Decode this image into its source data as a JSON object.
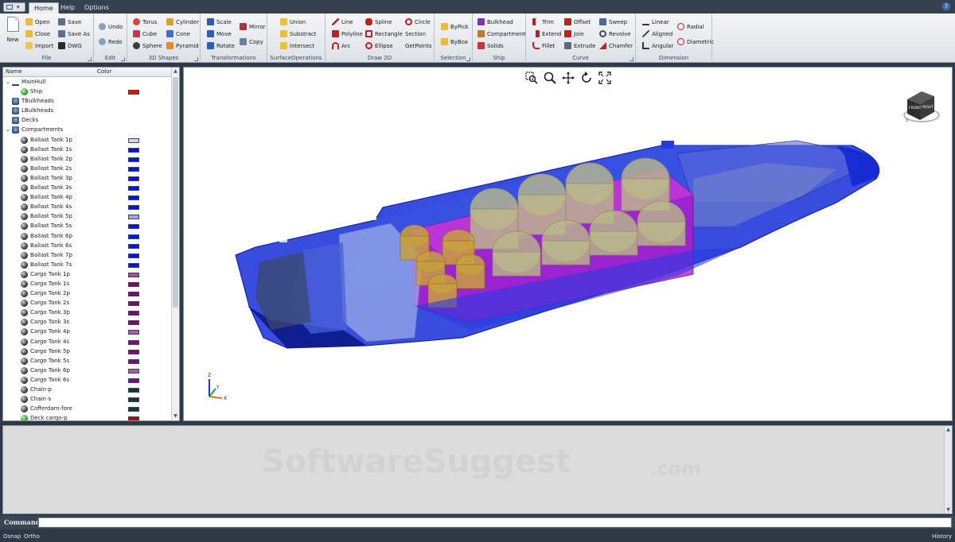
{
  "tabs": [
    "Home",
    "Help",
    "Options"
  ],
  "ribbon": {
    "file": {
      "label": "File",
      "new": "New",
      "open": "Open",
      "close": "Close",
      "import": "Import",
      "save": "Save",
      "save_as": "Save As",
      "dwg": "DWG"
    },
    "edit": {
      "label": "Edit",
      "undo": "Undo",
      "redo": "Redo"
    },
    "shapes3d": {
      "label": "3D Shapes",
      "torus": "Torus",
      "cube": "Cube",
      "sphere": "Sphere",
      "cylinder": "Cylinder",
      "cone": "Cone",
      "pyramid": "Pyramid"
    },
    "transformations": {
      "label": "Transformations",
      "scale": "Scale",
      "move": "Move",
      "rotate": "Rotate",
      "mirror": "Mirror",
      "copy": "Copy"
    },
    "surface_ops": {
      "label": "SurfaceOperations",
      "union": "Union",
      "substract": "Substract",
      "intersect": "Intersect"
    },
    "draw2d": {
      "label": "Draw 2D",
      "line": "Line",
      "polyline": "Polyline",
      "arc": "Arc",
      "spline": "Spline",
      "rectangle": "Rectangle",
      "ellipse": "Ellipse",
      "circle": "Circle",
      "section": "Section",
      "getpoints": "GetPoints"
    },
    "selection": {
      "label": "Selection",
      "bypick": "ByPick",
      "bybox": "ByBox"
    },
    "ship": {
      "label": "Ship",
      "bulkhead": "Bulkhead",
      "compartment": "Compartment",
      "solids": "Solids"
    },
    "curve": {
      "label": "Curve",
      "trim": "Trim",
      "extend": "Extend",
      "fillet": "Fillet",
      "offset": "Offset",
      "join": "Join",
      "extrude": "Extrude",
      "sweep": "Sweep",
      "revolve": "Revolve",
      "chamfer": "Chamfer"
    },
    "dimension": {
      "label": "Dimension",
      "linear": "Linear",
      "aligned": "Aligned",
      "angular": "Angular",
      "radial": "Radial",
      "diametric": "Diametric"
    }
  },
  "tree": {
    "col_name": "Name",
    "col_color": "Color",
    "rows": [
      {
        "label": "MainHull",
        "level": 0,
        "icon": "hull",
        "twisty": "⌄",
        "color": null
      },
      {
        "label": "Ship",
        "level": 2,
        "icon": "ship",
        "color": "#e01010",
        "selected": false
      },
      {
        "label": "TBulkheads",
        "level": 1,
        "icon": "group",
        "color": null
      },
      {
        "label": "LBulkheads",
        "level": 1,
        "icon": "group",
        "color": null
      },
      {
        "label": "Decks",
        "level": 1,
        "icon": "group",
        "color": null
      },
      {
        "label": "Compartments",
        "level": 0,
        "icon": "group",
        "twisty": "⌄",
        "color": null
      },
      {
        "label": "Ballast Tank 1p",
        "level": 2,
        "icon": "ball",
        "color": "#c8d8f5"
      },
      {
        "label": "Ballast Tank 1s",
        "level": 2,
        "icon": "ball",
        "color": "#0014e6"
      },
      {
        "label": "Ballast Tank 2p",
        "level": 2,
        "icon": "ball",
        "color": "#0014e6"
      },
      {
        "label": "Ballast Tank 2s",
        "level": 2,
        "icon": "ball",
        "color": "#0014e6"
      },
      {
        "label": "Ballast Tank 3p",
        "level": 2,
        "icon": "ball",
        "color": "#0014e6"
      },
      {
        "label": "Ballast Tank 3s",
        "level": 2,
        "icon": "ball",
        "color": "#0014e6"
      },
      {
        "label": "Ballast Tank 4p",
        "level": 2,
        "icon": "ball",
        "color": "#0014e6"
      },
      {
        "label": "Ballast Tank 4s",
        "level": 2,
        "icon": "ball",
        "color": "#0014e6"
      },
      {
        "label": "Ballast Tank 5p",
        "level": 2,
        "icon": "ball",
        "color": "#9aa8ea"
      },
      {
        "label": "Ballast Tank 5s",
        "level": 2,
        "icon": "ball",
        "color": "#0014e6"
      },
      {
        "label": "Ballast Tank 6p",
        "level": 2,
        "icon": "ball",
        "color": "#0014e6"
      },
      {
        "label": "Ballast Tank 6s",
        "level": 2,
        "icon": "ball",
        "color": "#0014e6"
      },
      {
        "label": "Ballast Tank 7p",
        "level": 2,
        "icon": "ball",
        "color": "#0014e6"
      },
      {
        "label": "Ballast Tank 7s",
        "level": 2,
        "icon": "ball",
        "color": "#0014e6"
      },
      {
        "label": "Cargo Tank 1p",
        "level": 2,
        "icon": "ball",
        "color": "#a050a8"
      },
      {
        "label": "Cargo Tank 1s",
        "level": 2,
        "icon": "ball",
        "color": "#7a0a7a"
      },
      {
        "label": "Cargo Tank 2p",
        "level": 2,
        "icon": "ball",
        "color": "#7a0a7a"
      },
      {
        "label": "Cargo Tank 2s",
        "level": 2,
        "icon": "ball",
        "color": "#7a0a7a"
      },
      {
        "label": "Cargo Tank 3p",
        "level": 2,
        "icon": "ball",
        "color": "#7a0a7a"
      },
      {
        "label": "Cargo Tank 3s",
        "level": 2,
        "icon": "ball",
        "color": "#7a0a7a"
      },
      {
        "label": "Cargo Tank 4p",
        "level": 2,
        "icon": "ball",
        "color": "#a060a8"
      },
      {
        "label": "Cargo Tank 4s",
        "level": 2,
        "icon": "ball",
        "color": "#7a0a7a"
      },
      {
        "label": "Cargo Tank 5p",
        "level": 2,
        "icon": "ball",
        "color": "#7a0a7a"
      },
      {
        "label": "Cargo Tank 5s",
        "level": 2,
        "icon": "ball",
        "color": "#7a0a7a"
      },
      {
        "label": "Cargo Tank 6p",
        "level": 2,
        "icon": "ball",
        "color": "#a060a8"
      },
      {
        "label": "Cargo Tank 6s",
        "level": 2,
        "icon": "ball",
        "color": "#7a0a7a"
      },
      {
        "label": "Chain-p",
        "level": 2,
        "icon": "ball",
        "color": "#0f3a36"
      },
      {
        "label": "Chain-s",
        "level": 2,
        "icon": "ball",
        "color": "#0f3a36"
      },
      {
        "label": "Cofferdam-fore",
        "level": 2,
        "icon": "ball",
        "color": "#0f3a36"
      },
      {
        "label": "Deck cargo-p",
        "level": 2,
        "icon": "ship",
        "color": "#a01010"
      }
    ]
  },
  "viewport": {
    "axis_x": "X",
    "axis_y": "Y",
    "axis_z": "Z",
    "cube_face_front": "FRONT",
    "cube_face_right": "RIGHT",
    "cube_compass": "S"
  },
  "history": {
    "watermark": "SoftwareSuggest",
    "watermark_suffix": ".com"
  },
  "command": {
    "label": "Command:",
    "value": ""
  },
  "status": {
    "osnap": "Osnap",
    "ortho": "Ortho",
    "history": "History"
  },
  "colors": {
    "chrome_dark": "#35414f",
    "ribbon_bg": "#e6e9ed",
    "hull_blue": "#1a2fd0",
    "cargo_magenta": "#b015c8",
    "tank_olive": "#b9b98a"
  }
}
